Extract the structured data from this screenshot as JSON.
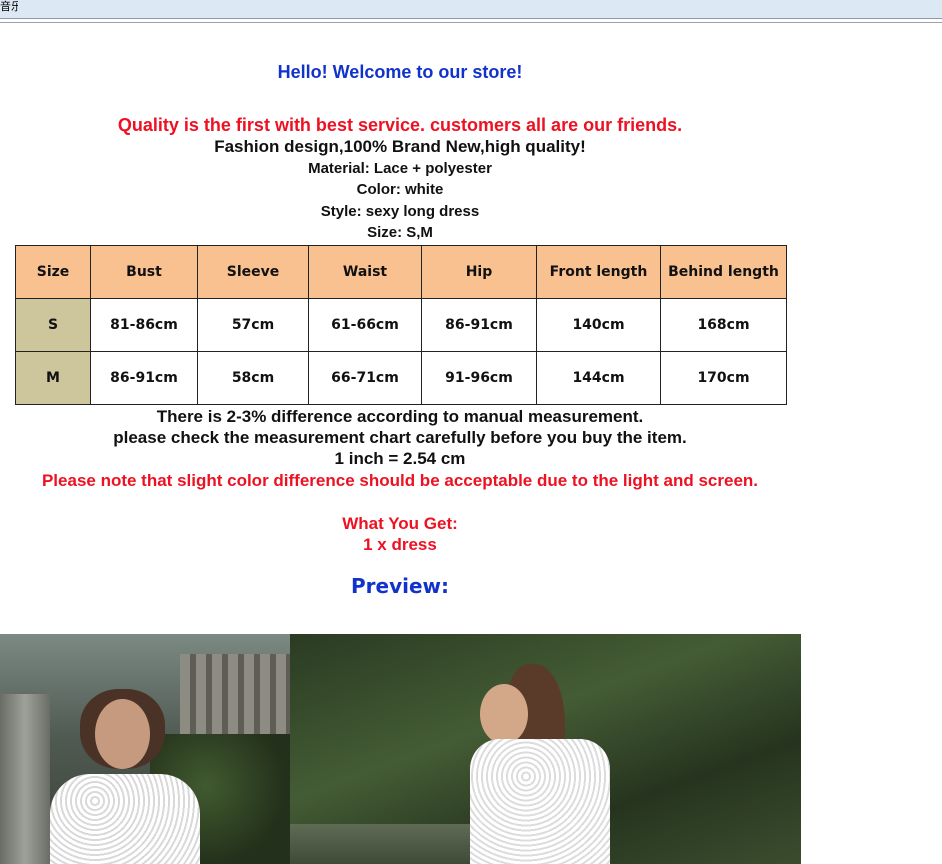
{
  "window": {
    "title_fragment": "音乐"
  },
  "intro": {
    "welcome": "Hello! Welcome to our store!",
    "quality": "Quality is the first with best service. customers all are our friends.",
    "fashion": "Fashion design,100% Brand New,high quality!",
    "material": "Material: Lace + polyester",
    "color": "Color: white",
    "style": "Style: sexy long dress",
    "size": "Size: S,M"
  },
  "size_table": {
    "headers": [
      "Size",
      "Bust",
      "Sleeve",
      "Waist",
      "Hip",
      "Front length",
      "Behind length"
    ],
    "rows": [
      [
        "S",
        "81-86cm",
        "57cm",
        "61-66cm",
        "86-91cm",
        "140cm",
        "168cm"
      ],
      [
        "M",
        "86-91cm",
        "58cm",
        "66-71cm",
        "91-96cm",
        "144cm",
        "170cm"
      ]
    ]
  },
  "notes": {
    "difference": "There is 2-3% difference according to manual measurement.",
    "check": "please check the measurement chart carefully before you buy the item.",
    "inch": "1 inch = 2.54 cm",
    "color_note": "Please note that slight color difference should be acceptable due to the light and screen."
  },
  "package": {
    "heading": "What You Get:",
    "item": "1 x dress"
  },
  "preview": {
    "label": "Preview:"
  },
  "colors": {
    "blue_text": "#1133cc",
    "red_text": "#ee1122",
    "header_bg": "#f9c090",
    "size_cell_bg": "#cdc59c"
  }
}
